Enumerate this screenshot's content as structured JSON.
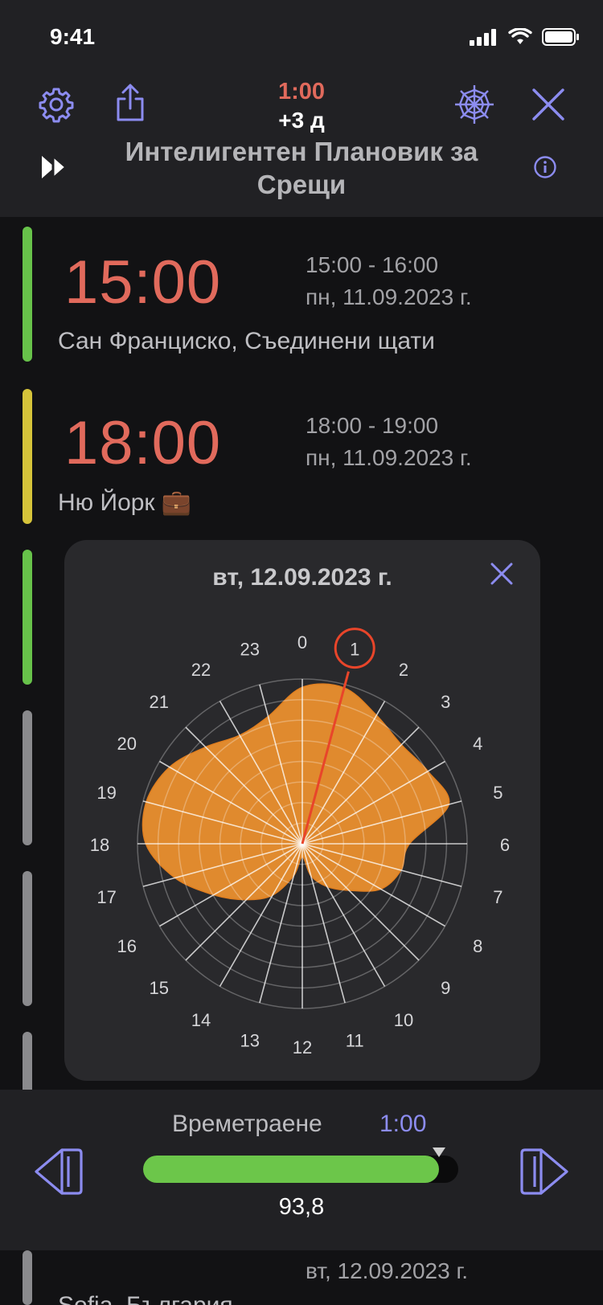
{
  "status_bar": {
    "time": "9:41"
  },
  "header": {
    "duration": "1:00",
    "day_offset": "+3 д",
    "title": "Интелигентен Плановик за Срещи"
  },
  "meetings": [
    {
      "time": "15:00",
      "range": "15:00 - 16:00",
      "date": "пн, 11.09.2023 г.",
      "location": "Сан Франциско, Съединени щати",
      "bar_color": "#67c24a"
    },
    {
      "time": "18:00",
      "range": "18:00 - 19:00",
      "date": "пн, 11.09.2023 г.",
      "location": "Ню Йорк 💼",
      "bar_color": "#d6c43a"
    }
  ],
  "popup": {
    "date": "вт, 12.09.2023 г.",
    "selected_hour": 1,
    "hour_labels": [
      "0",
      "1",
      "2",
      "3",
      "4",
      "5",
      "6",
      "7",
      "8",
      "9",
      "10",
      "11",
      "12",
      "13",
      "14",
      "15",
      "16",
      "17",
      "18",
      "19",
      "20",
      "21",
      "22",
      "23"
    ],
    "radial_values": [
      0.95,
      0.98,
      0.9,
      0.85,
      0.88,
      0.92,
      0.65,
      0.62,
      0.55,
      0.4,
      0.3,
      0.2,
      0.08,
      0.2,
      0.36,
      0.48,
      0.62,
      0.8,
      0.95,
      0.98,
      0.93,
      0.83,
      0.76,
      0.8
    ],
    "fill_color": "#f0922f",
    "pointer_color": "#e8452a"
  },
  "bottom_bar": {
    "duration_label": "Времетраене",
    "duration_value": "1:00",
    "slider_value": "93,8",
    "slider_fraction": 0.938,
    "peek_date": "вт, 12.09.2023 г.",
    "peek_location": "Sofia, България"
  }
}
